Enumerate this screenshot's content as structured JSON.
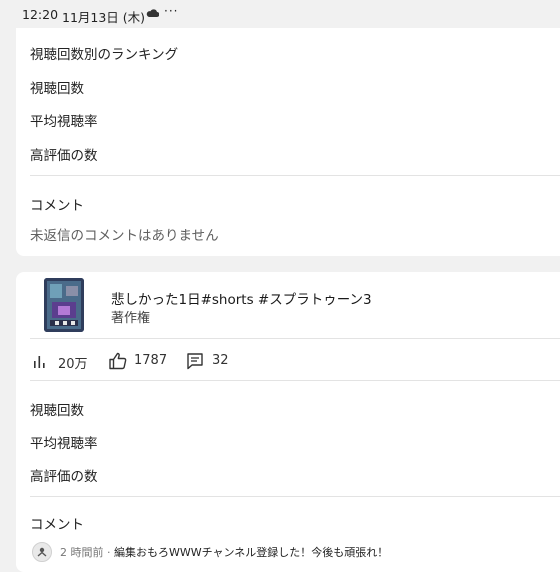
{
  "status_bar": {
    "time": "12:20",
    "date": "11月13日 (木)",
    "dots": "···"
  },
  "card1": {
    "rows": [
      "視聴回数別のランキング",
      "視聴回数",
      "平均視聴率",
      "高評価の数"
    ],
    "comments_header": "コメント",
    "comments_empty": "未返信のコメントはありません"
  },
  "card2": {
    "video": {
      "title": "悲しかった1日#shorts #スプラトゥーン3",
      "subtitle": "著作権"
    },
    "stats": {
      "views": "20万",
      "likes": "1787",
      "comments": "32"
    },
    "rows": [
      "視聴回数",
      "平均視聴率",
      "高評価の数"
    ],
    "comments_header": "コメント",
    "latest_comment": {
      "meta": "2 時間前 · ",
      "text": "編集おもろWWWチャンネル登録した！今後も頑張れ！"
    }
  },
  "colors": {
    "background": "#f1f1f1",
    "card": "#ffffff",
    "divider": "#e3e3e3",
    "muted_text": "#606060"
  }
}
